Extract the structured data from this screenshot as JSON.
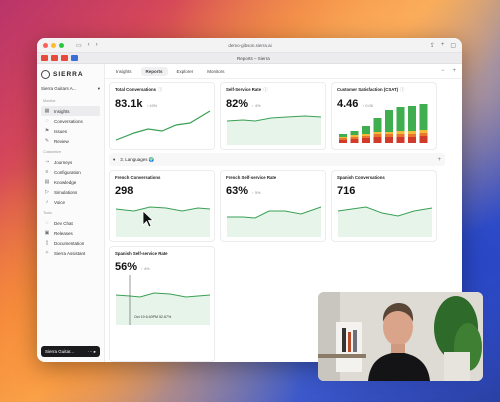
{
  "browser": {
    "url": "demo-gibson.sierra.ai",
    "tab_title": "Reports – Sierra"
  },
  "sidebar": {
    "logo_text": "SIERRA",
    "agent_name": "Sierra Guitars A...",
    "sections": [
      {
        "title": "Monitor",
        "items": [
          {
            "label": "Insights",
            "icon": "chart-icon",
            "active": true
          },
          {
            "label": "Conversations",
            "icon": "chat-icon"
          },
          {
            "label": "Issues",
            "icon": "flag-icon"
          },
          {
            "label": "Review",
            "icon": "pen-icon"
          }
        ]
      },
      {
        "title": "Customize",
        "items": [
          {
            "label": "Journeys",
            "icon": "journey-icon"
          },
          {
            "label": "Configuration",
            "icon": "sliders-icon"
          },
          {
            "label": "Knowledge",
            "icon": "book-icon"
          },
          {
            "label": "Simulations",
            "icon": "play-icon"
          },
          {
            "label": "Voice",
            "icon": "mic-icon"
          }
        ]
      },
      {
        "title": "Tools",
        "items": [
          {
            "label": "Dev Chat",
            "icon": "chat-icon"
          },
          {
            "label": "Releases",
            "icon": "box-icon"
          },
          {
            "label": "Documentation",
            "icon": "doc-icon"
          },
          {
            "label": "Sierra Assistant",
            "icon": "sparkle-icon"
          }
        ]
      }
    ],
    "bottom_label": "Sierra Guitar..."
  },
  "topnav": {
    "tabs": [
      "Insights",
      "Reports",
      "Explorer",
      "Monitors"
    ],
    "active_tab": "Reports"
  },
  "cards": {
    "total_conversations": {
      "title": "Total Conversations",
      "value": "83.1k",
      "delta": "↑ 43%"
    },
    "self_service_rate": {
      "title": "Self-Service Rate",
      "value": "82%",
      "delta": "↑ 4%"
    },
    "csat": {
      "title": "Customer Satisfaction (CSAT)",
      "value": "4.46",
      "delta": "↑ 0.08"
    },
    "french_conversations": {
      "title": "French Conversations",
      "value": "298"
    },
    "french_self_service": {
      "title": "French Self-service Rate",
      "value": "63%",
      "delta": "↑ 5%"
    },
    "spanish_conversations": {
      "title": "Spanish Conversations",
      "value": "716"
    },
    "spanish_self_service": {
      "title": "Spanish Self-service Rate",
      "value": "56%",
      "delta": "↑ 4%",
      "tooltip": "Oct 19 6:40PM  52.67%"
    }
  },
  "section": {
    "title": "3. Languages 🌍"
  },
  "colors": {
    "accent_green": "#3aa055",
    "bar_green": "#3fae4f",
    "bar_yellow": "#f2b93b",
    "bar_orange": "#e8762d",
    "bar_red": "#d23a2a"
  }
}
